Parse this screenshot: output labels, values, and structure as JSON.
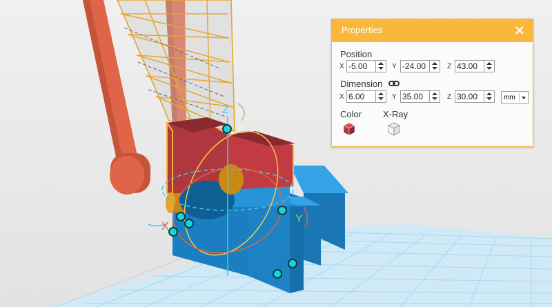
{
  "panel": {
    "title": "Properties",
    "position_label": "Position",
    "dimension_label": "Dimension",
    "color_label": "Color",
    "xray_label": "X-Ray",
    "position": {
      "x_axis": "X",
      "x_value": "-5.00",
      "y_axis": "Y",
      "y_value": "-24.00",
      "z_axis": "Z",
      "z_value": "43.00"
    },
    "dimension": {
      "x_axis": "X",
      "x_value": "6.00",
      "y_axis": "Y",
      "y_value": "35.00",
      "z_axis": "Z",
      "z_value": "30.00"
    },
    "unit": "mm"
  },
  "gizmo": {
    "x_label": "X",
    "y_label": "Y",
    "z_label": "Z"
  },
  "colors": {
    "accent": "#f9b83b",
    "model_blue": "#1d82c4",
    "model_red": "#b0373e",
    "arm": "#e06548",
    "handle": "#17d6d6",
    "grid": "#a9d8ef"
  }
}
